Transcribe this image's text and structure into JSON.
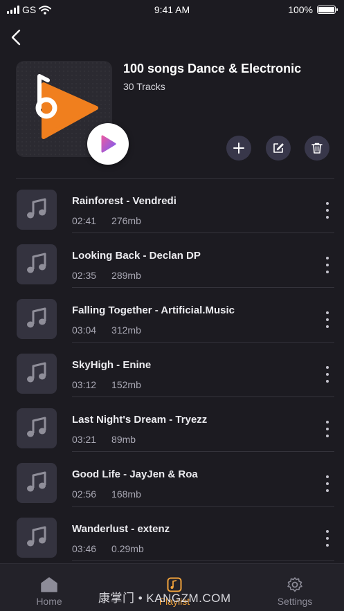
{
  "status": {
    "carrier": "GS",
    "time": "9:41 AM",
    "battery": "100%"
  },
  "playlist": {
    "title": "100 songs Dance & Electronic",
    "tracks_count": "30 Tracks"
  },
  "icons": {
    "back": "chevron-left-icon",
    "play": "play-icon",
    "add": "plus-icon",
    "edit": "edit-icon",
    "delete": "trash-icon",
    "track_thumb": "music-note-icon",
    "more": "more-vertical-icon"
  },
  "colors": {
    "background": "#1c1b21",
    "accent": "#f0a23b",
    "logo_orange": "#f07f1e",
    "play_gradient_start": "#e55aa6",
    "play_gradient_end": "#7c5cf0"
  },
  "tracks": [
    {
      "title": "Rainforest - Vendredi",
      "duration": "02:41",
      "size": "276mb"
    },
    {
      "title": "Looking Back - Declan DP",
      "duration": "02:35",
      "size": "289mb"
    },
    {
      "title": "Falling Together - Artificial.Music",
      "duration": "03:04",
      "size": "312mb"
    },
    {
      "title": "SkyHigh - Enine",
      "duration": "03:12",
      "size": "152mb"
    },
    {
      "title": "Last Night's Dream - Tryezz",
      "duration": "03:21",
      "size": "89mb"
    },
    {
      "title": "Good Life - JayJen & Roa",
      "duration": "02:56",
      "size": "168mb"
    },
    {
      "title": "Wanderlust - extenz",
      "duration": "03:46",
      "size": "0.29mb"
    }
  ],
  "tabs": {
    "home": "Home",
    "playlist": "Playlist",
    "settings": "Settings"
  },
  "watermark": "康掌门 • KANGZM.COM"
}
